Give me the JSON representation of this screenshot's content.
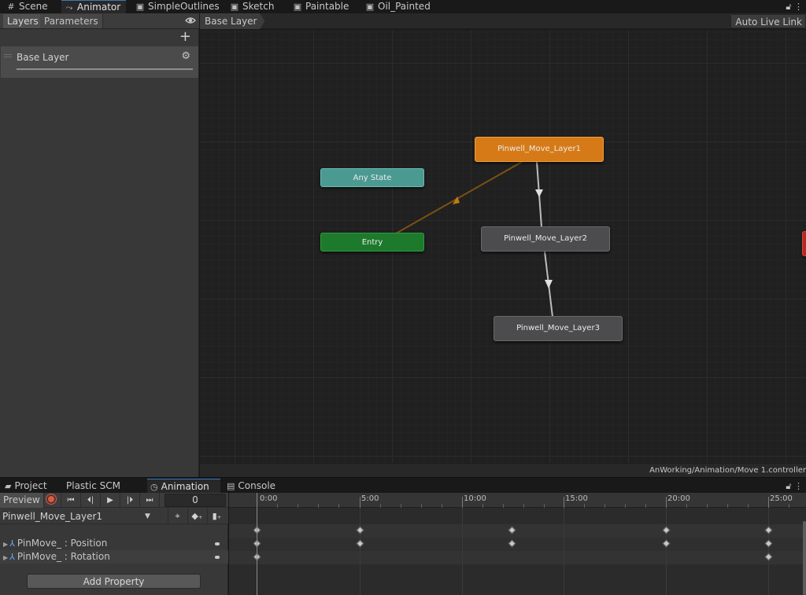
{
  "top_tabs": [
    {
      "label": "Scene",
      "icon": "grid-icon"
    },
    {
      "label": "Animator",
      "icon": "animator-icon"
    },
    {
      "label": "SimpleOutlines",
      "icon": "shader-icon"
    },
    {
      "label": "Sketch",
      "icon": "shader-icon"
    },
    {
      "label": "Paintable",
      "icon": "shader-icon"
    },
    {
      "label": "Oil_Painted",
      "icon": "shader-icon"
    }
  ],
  "animator": {
    "left_tabs": [
      "Layers",
      "Parameters"
    ],
    "layer_name": "Base Layer",
    "breadcrumb": "Base Layer",
    "auto_live_link": "Auto Live Link",
    "asset_path": "AnWorking/Animation/Move 1.controller",
    "states": {
      "any_state": "Any State",
      "entry": "Entry",
      "layer1": "Pinwell_Move_Layer1",
      "layer2": "Pinwell_Move_Layer2",
      "layer3": "Pinwell_Move_Layer3"
    },
    "colors": {
      "default_state": "#d67a17",
      "any_state": "#4b9a92",
      "entry": "#1d7a2c",
      "state": "#4c4c4e",
      "exit_partial": "#b42a22"
    }
  },
  "bottom_tabs": [
    {
      "label": "Project",
      "icon": "folder-icon"
    },
    {
      "label": "Plastic SCM",
      "icon": ""
    },
    {
      "label": "Animation",
      "icon": "clock-icon"
    },
    {
      "label": "Console",
      "icon": "console-icon"
    }
  ],
  "animation": {
    "preview_label": "Preview",
    "frame": "0",
    "clip": "Pinwell_Move_Layer1",
    "properties": [
      {
        "label": "PinMove_ : Position"
      },
      {
        "label": "PinMove_ : Rotation"
      }
    ],
    "add_property": "Add Property",
    "ruler_labels": [
      "0:00",
      "5:00",
      "10:00",
      "15:00",
      "20:00",
      "25:00"
    ]
  }
}
